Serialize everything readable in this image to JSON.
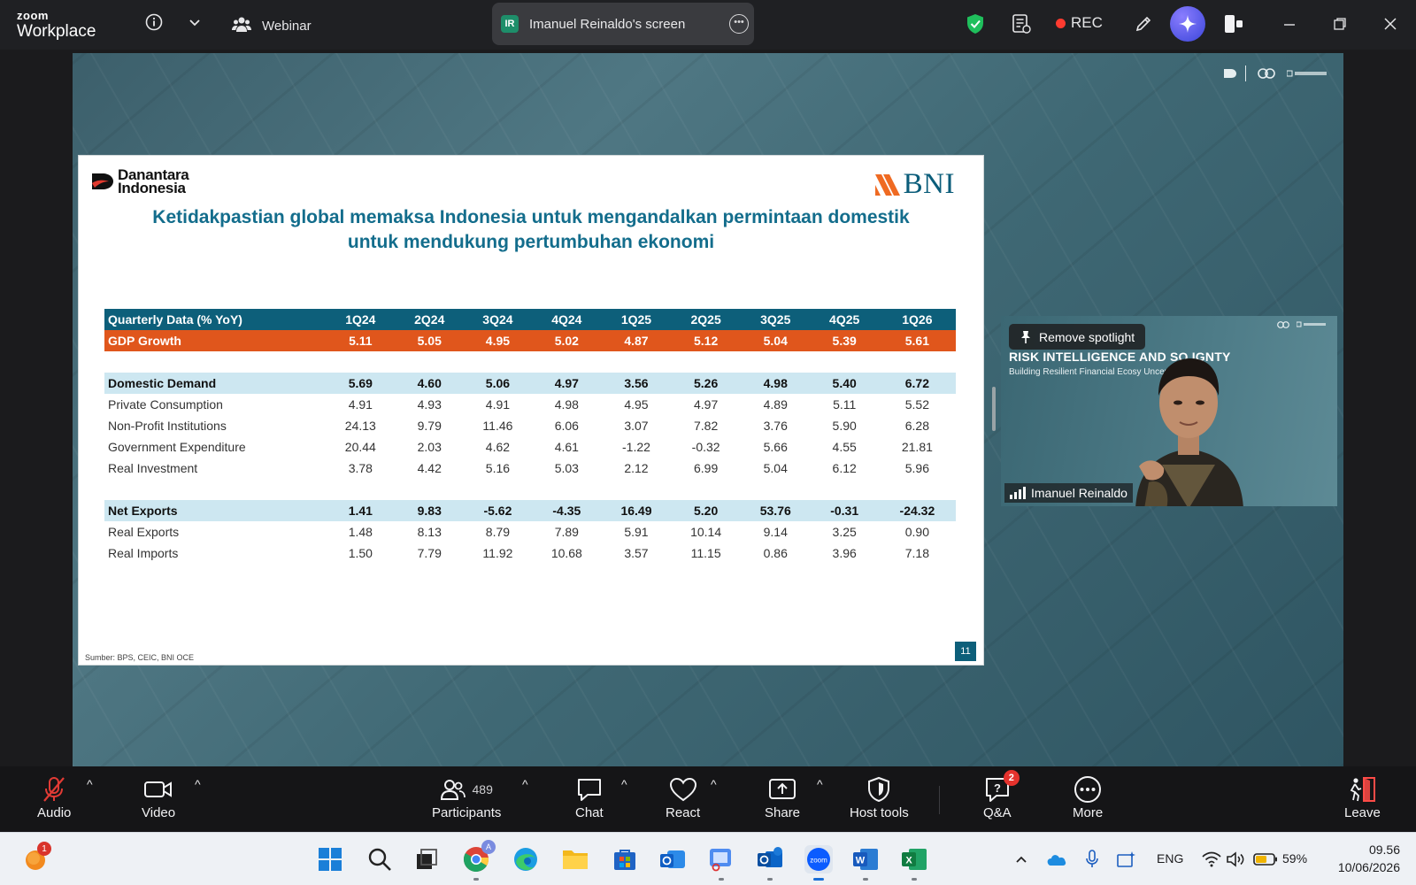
{
  "app": {
    "brand_top": "zoom",
    "brand_bottom": "Workplace",
    "webinar_label": "Webinar"
  },
  "share": {
    "badge": "IR",
    "title": "Imanuel Reinaldo's screen"
  },
  "recording": {
    "label": "REC"
  },
  "slide": {
    "logo_left": "Danantara Indonesia",
    "logo_left_line1": "Danantara",
    "logo_left_line2": "Indonesia",
    "logo_right": "BNI",
    "title_line1": "Ketidakpastian global memaksa Indonesia untuk mengandalkan permintaan domestik",
    "title_line2": "untuk mendukung pertumbuhan ekonomi",
    "source": "Sumber: BPS, CEIC, BNI OCE",
    "page_number": "11",
    "table": {
      "header": [
        "Quarterly Data (% YoY)",
        "1Q24",
        "2Q24",
        "3Q24",
        "4Q24",
        "1Q25",
        "2Q25",
        "3Q25",
        "4Q25",
        "1Q26"
      ],
      "gdp": [
        "GDP Growth",
        "5.11",
        "5.05",
        "4.95",
        "5.02",
        "4.87",
        "5.12",
        "5.04",
        "5.39",
        "5.61"
      ],
      "domestic": [
        "Domestic Demand",
        "5.69",
        "4.60",
        "5.06",
        "4.97",
        "3.56",
        "5.26",
        "4.98",
        "5.40",
        "6.72"
      ],
      "private": [
        "Private Consumption",
        "4.91",
        "4.93",
        "4.91",
        "4.98",
        "4.95",
        "4.97",
        "4.89",
        "5.11",
        "5.52"
      ],
      "npi": [
        "Non-Profit Institutions",
        "24.13",
        "9.79",
        "11.46",
        "6.06",
        "3.07",
        "7.82",
        "3.76",
        "5.90",
        "6.28"
      ],
      "gov": [
        "Government Expenditure",
        "20.44",
        "2.03",
        "4.62",
        "4.61",
        "-1.22",
        "-0.32",
        "5.66",
        "4.55",
        "21.81"
      ],
      "inv": [
        "Real Investment",
        "3.78",
        "4.42",
        "5.16",
        "5.03",
        "2.12",
        "6.99",
        "5.04",
        "6.12",
        "5.96"
      ],
      "netexp": [
        "Net Exports",
        "1.41",
        "9.83",
        "-5.62",
        "-4.35",
        "16.49",
        "5.20",
        "53.76",
        "-0.31",
        "-24.32"
      ],
      "exports": [
        "Real Exports",
        "1.48",
        "8.13",
        "8.79",
        "7.89",
        "5.91",
        "10.14",
        "9.14",
        "3.25",
        "0.90"
      ],
      "imports": [
        "Real Imports",
        "1.50",
        "7.79",
        "11.92",
        "10.68",
        "3.57",
        "11.15",
        "0.86",
        "3.96",
        "7.18"
      ]
    }
  },
  "video": {
    "spotlight_button": "Remove spotlight",
    "backdrop_title": "RISK INTELLIGENCE AND SO        IGNTY",
    "backdrop_subtitle": "Building Resilient Financial Ecosy                  Uncertain World",
    "participant_name": "Imanuel Reinaldo"
  },
  "toolbar": {
    "audio": "Audio",
    "video": "Video",
    "participants": "Participants",
    "participants_count": "489",
    "chat": "Chat",
    "react": "React",
    "share": "Share",
    "host_tools": "Host tools",
    "qa": "Q&A",
    "qa_badge": "2",
    "more": "More",
    "leave": "Leave"
  },
  "taskbar": {
    "notification_badge": "1",
    "chrome_profile": "A",
    "zoom_label": "zoom",
    "language": "ENG",
    "battery": "59%",
    "time": "09.56",
    "date": "10/06/2026"
  },
  "colors": {
    "slide_header": "#0d5f7a",
    "gdp_row": "#e0561c",
    "group_row": "#cde7f1",
    "title_blue": "#136d8c"
  }
}
